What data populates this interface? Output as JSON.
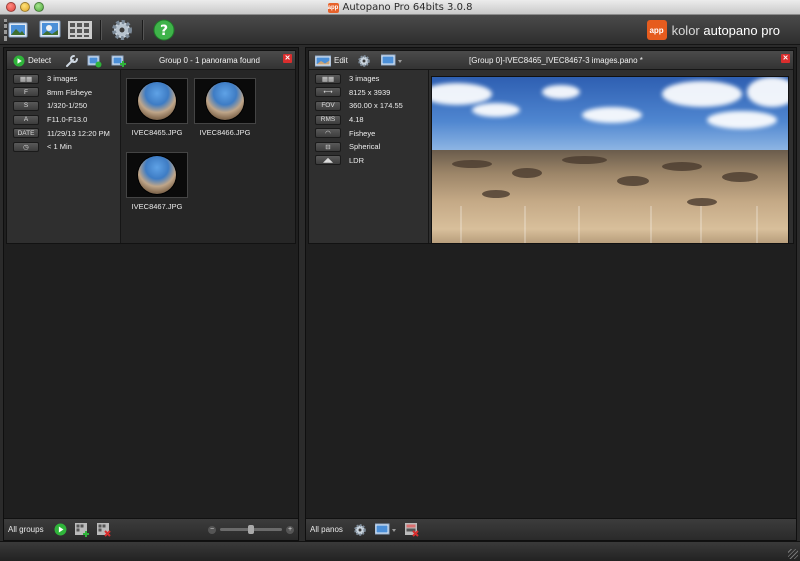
{
  "window": {
    "title": "Autopano Pro 64bits 3.0.8",
    "app_badge": "app"
  },
  "brand": {
    "badge": "app",
    "text_light": "kolor ",
    "text_bold": "autopano pro"
  },
  "left_panel": {
    "detect_label": "Detect",
    "group_title": "Group 0 - 1 panorama found",
    "info": [
      {
        "tag": "",
        "value": "3 images",
        "icon": "grid-icon"
      },
      {
        "tag": "F",
        "value": "8mm Fisheye"
      },
      {
        "tag": "S",
        "value": "1/320-1/250"
      },
      {
        "tag": "A",
        "value": "F11.0-F13.0"
      },
      {
        "tag": "DATE",
        "value": "11/29/13 12:20 PM"
      },
      {
        "tag": "",
        "value": "< 1 Min",
        "icon": "clock-icon"
      }
    ],
    "thumbnails": [
      {
        "name": "IVEC8465.JPG"
      },
      {
        "name": "IVEC8466.JPG"
      },
      {
        "name": "IVEC8467.JPG"
      }
    ],
    "footer_label": "All groups"
  },
  "right_panel": {
    "edit_label": "Edit",
    "pano_title": "[Group 0]-IVEC8465_IVEC8467-3 images.pano *",
    "info": [
      {
        "tag": "",
        "value": "3 images",
        "icon": "grid-icon"
      },
      {
        "tag": "",
        "value": "8125 x 3939",
        "icon": "width-arrows-icon"
      },
      {
        "tag": "FOV",
        "value": "360.00 x 174.55"
      },
      {
        "tag": "RMS",
        "value": "4.18"
      },
      {
        "tag": "",
        "value": "Fisheye",
        "icon": "fisheye-lens-icon"
      },
      {
        "tag": "",
        "value": "Spherical",
        "icon": "spherical-projection-icon"
      },
      {
        "tag": "",
        "value": "LDR",
        "icon": "ldr-icon"
      }
    ],
    "footer_label": "All panos"
  },
  "colors": {
    "accent_orange": "#e65c1e",
    "close_red": "#d92d2d",
    "play_green": "#2fb43a"
  }
}
